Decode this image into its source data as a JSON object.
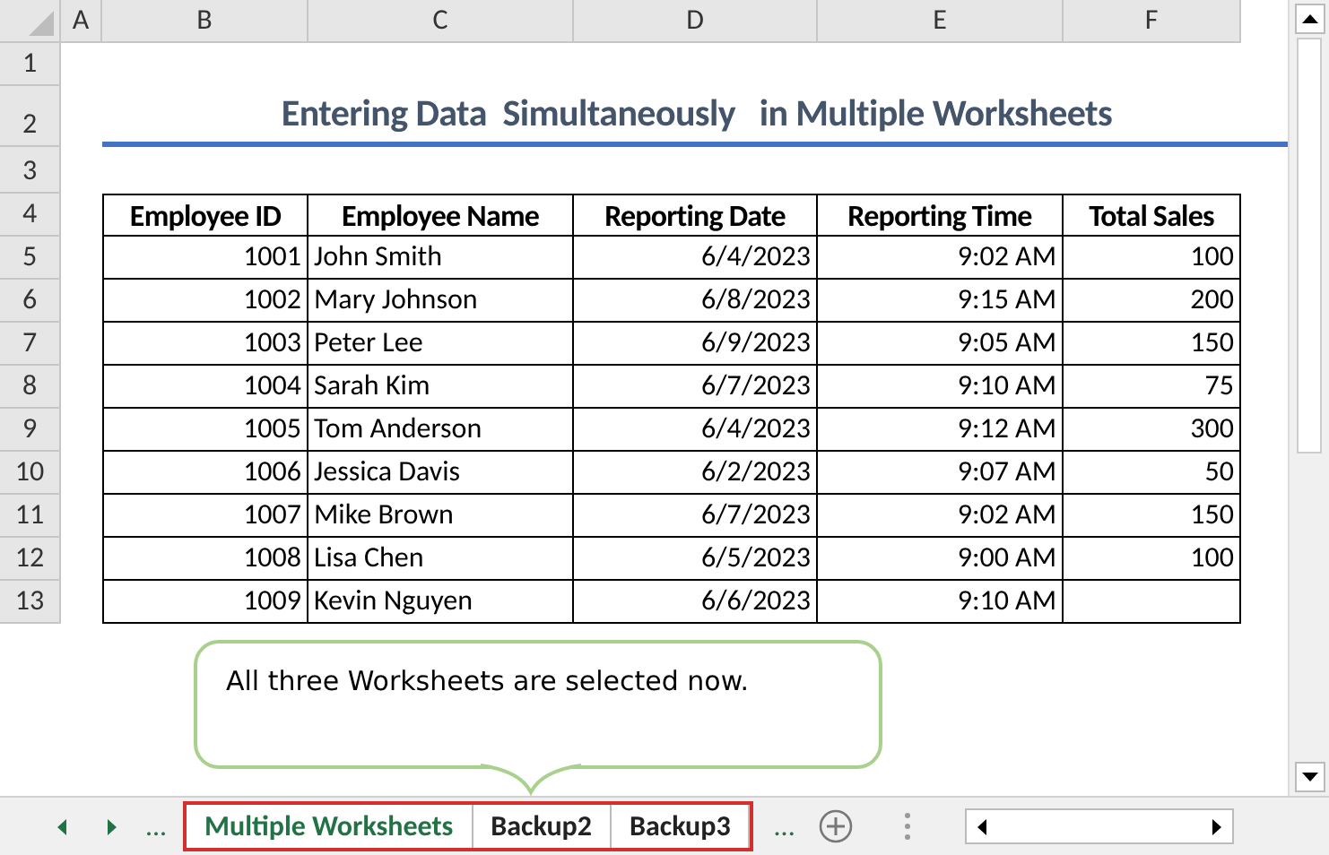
{
  "column_headers": [
    "A",
    "B",
    "C",
    "D",
    "E",
    "F"
  ],
  "row_numbers": [
    "1",
    "2",
    "3",
    "4",
    "5",
    "6",
    "7",
    "8",
    "9",
    "10",
    "11",
    "12",
    "13"
  ],
  "title": "Entering Data  Simultaneously   in Multiple Worksheets",
  "table": {
    "columns": [
      "Employee ID",
      "Employee Name",
      "Reporting Date",
      "Reporting Time",
      "Total Sales"
    ],
    "rows": [
      {
        "id": "1001",
        "name": "John Smith",
        "date": "6/4/2023",
        "time": "9:02 AM",
        "sales": "100"
      },
      {
        "id": "1002",
        "name": "Mary Johnson",
        "date": "6/8/2023",
        "time": "9:15 AM",
        "sales": "200"
      },
      {
        "id": "1003",
        "name": "Peter Lee",
        "date": "6/9/2023",
        "time": "9:05 AM",
        "sales": "150"
      },
      {
        "id": "1004",
        "name": "Sarah Kim",
        "date": "6/7/2023",
        "time": "9:10 AM",
        "sales": "75"
      },
      {
        "id": "1005",
        "name": "Tom Anderson",
        "date": "6/4/2023",
        "time": "9:12 AM",
        "sales": "300"
      },
      {
        "id": "1006",
        "name": "Jessica Davis",
        "date": "6/2/2023",
        "time": "9:07 AM",
        "sales": "50"
      },
      {
        "id": "1007",
        "name": "Mike Brown",
        "date": "6/7/2023",
        "time": "9:02 AM",
        "sales": "150"
      },
      {
        "id": "1008",
        "name": "Lisa Chen",
        "date": "6/5/2023",
        "time": "9:00 AM",
        "sales": "100"
      },
      {
        "id": "1009",
        "name": "Kevin Nguyen",
        "date": "6/6/2023",
        "time": "9:10 AM"
      }
    ]
  },
  "callout": "All three Worksheets are selected now.",
  "sheet_tabs": {
    "left_more": "...",
    "tabs": [
      {
        "label": "Multiple Worksheets",
        "selected": true,
        "active": true
      },
      {
        "label": "Backup2",
        "selected": true,
        "active": false
      },
      {
        "label": "Backup3",
        "selected": true,
        "active": false
      }
    ],
    "right_more": "..."
  }
}
